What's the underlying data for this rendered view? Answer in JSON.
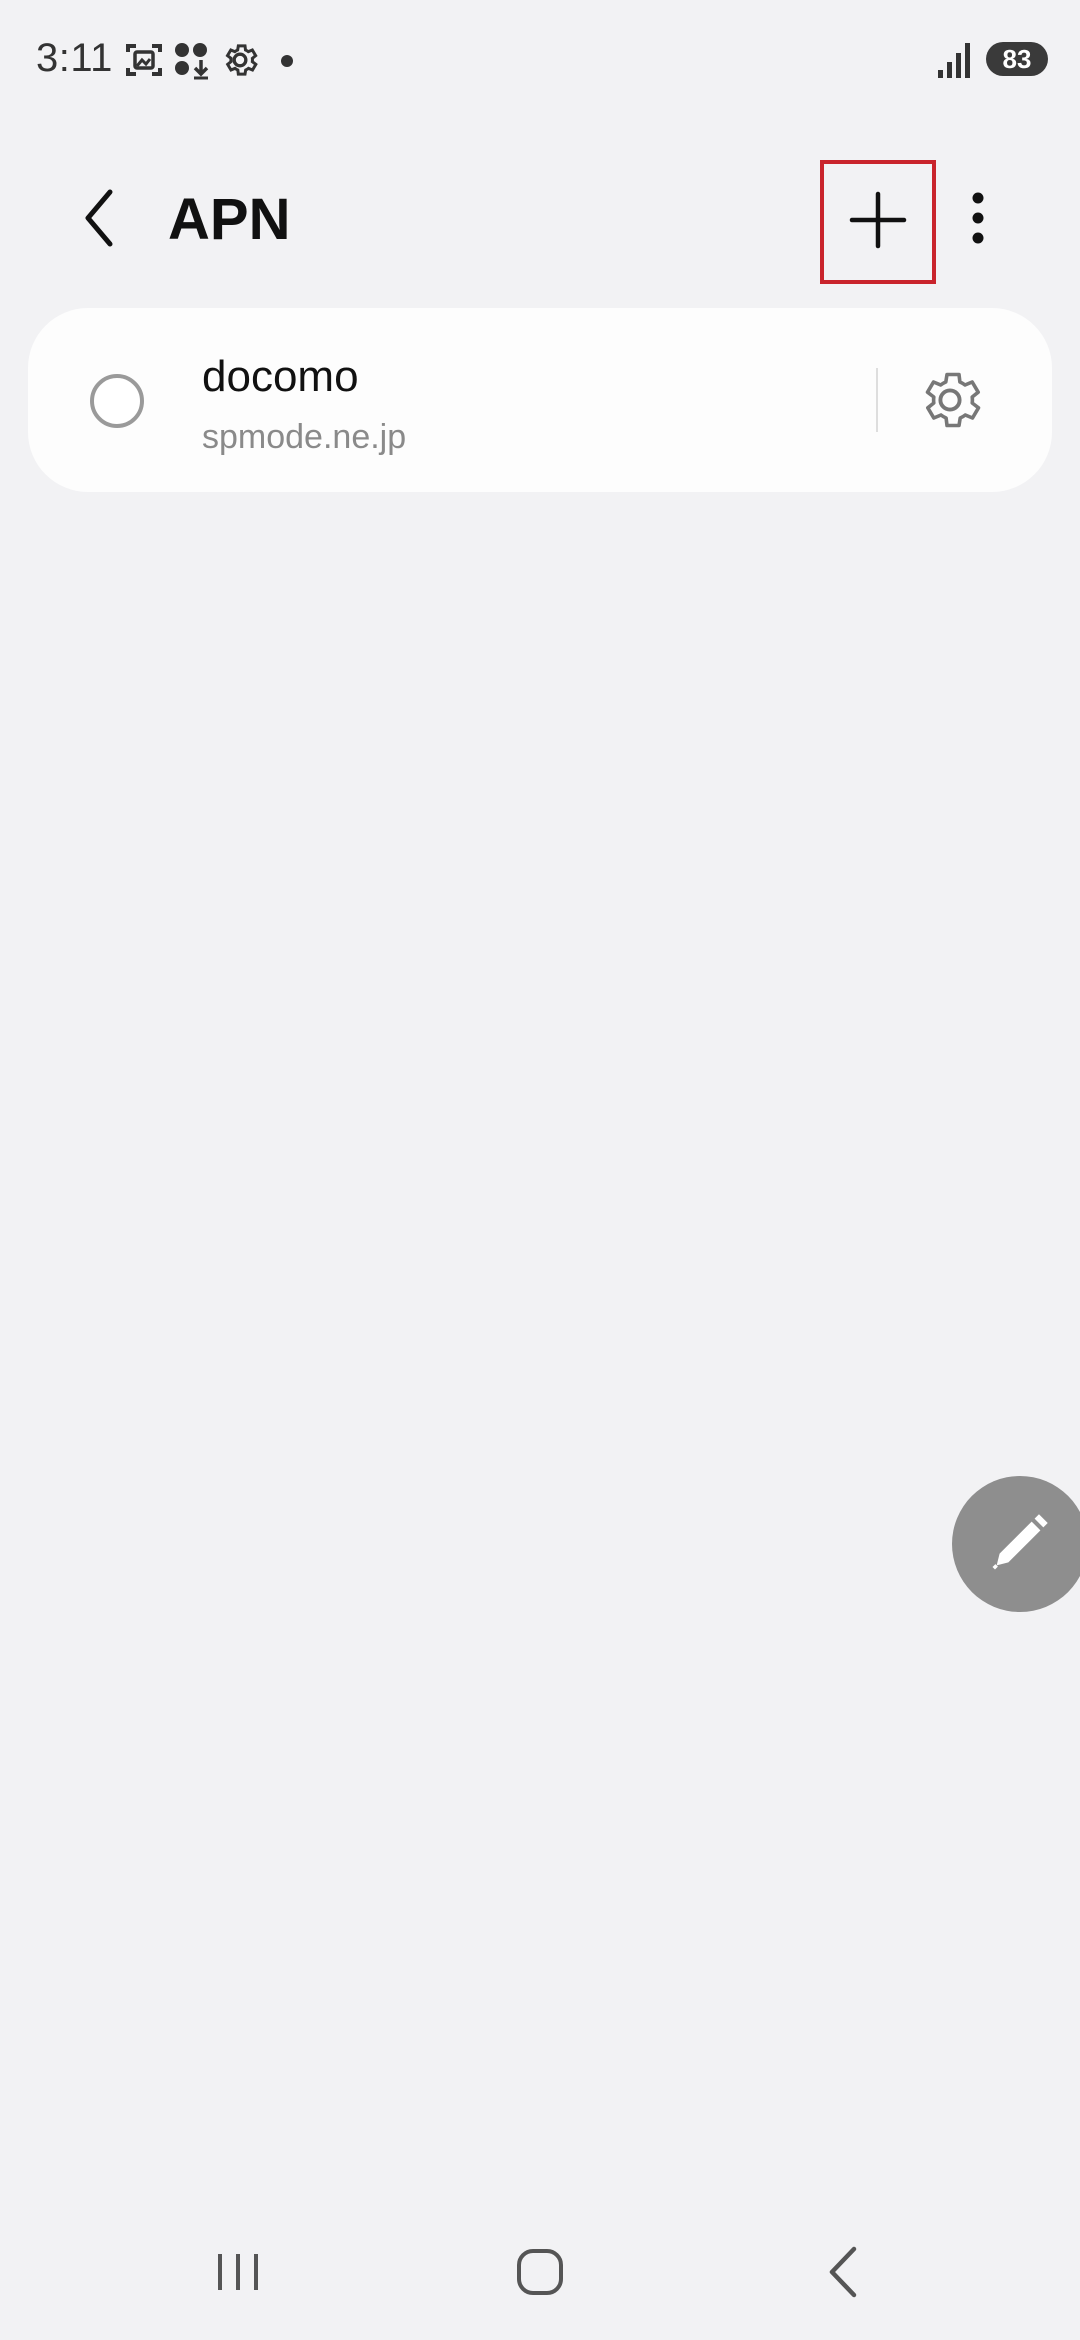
{
  "status_bar": {
    "time": "3:11",
    "battery": "83",
    "icons": [
      "screenshot-icon",
      "app-download-icon",
      "settings-gear-icon",
      "notification-dot-icon",
      "signal-icon",
      "battery-icon"
    ]
  },
  "header": {
    "title": "APN",
    "back_icon": "chevron-left-icon",
    "add_icon": "plus-icon",
    "more_icon": "more-vertical-icon",
    "add_highlight_color": "#c9242c"
  },
  "apn_list": [
    {
      "name": "docomo",
      "apn": "spmode.ne.jp",
      "selected": false
    }
  ],
  "fab": {
    "icon": "pencil-icon"
  },
  "nav_bar": {
    "icons": [
      "recents-icon",
      "home-icon",
      "back-icon"
    ]
  },
  "colors": {
    "background": "#f2f2f4",
    "card": "#fdfdfd",
    "fab": "#8e8e8e"
  }
}
